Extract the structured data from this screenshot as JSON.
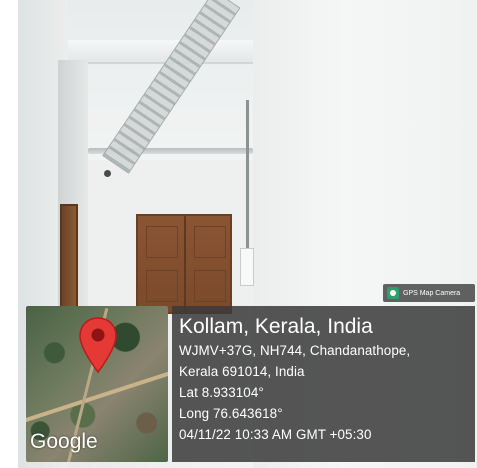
{
  "watermark": {
    "app_name": "GPS Map Camera",
    "icon": "gps-map-camera-icon"
  },
  "map": {
    "provider_logo": "Google",
    "pin_color": "#e53935",
    "pin_icon": "map-pin-icon"
  },
  "location": {
    "title": "Kollam, Kerala, India",
    "address_line1": "WJMV+37G, NH744, Chandanathope,",
    "address_line2": "Kerala 691014, India",
    "latitude": "Lat 8.933104°",
    "longitude": "Long 76.643618°",
    "timestamp": "04/11/22 10:33 AM GMT +05:30"
  },
  "colors": {
    "overlay_bg": "#3a3a3a",
    "text": "#ffffff",
    "door": "#7b4a2b"
  }
}
